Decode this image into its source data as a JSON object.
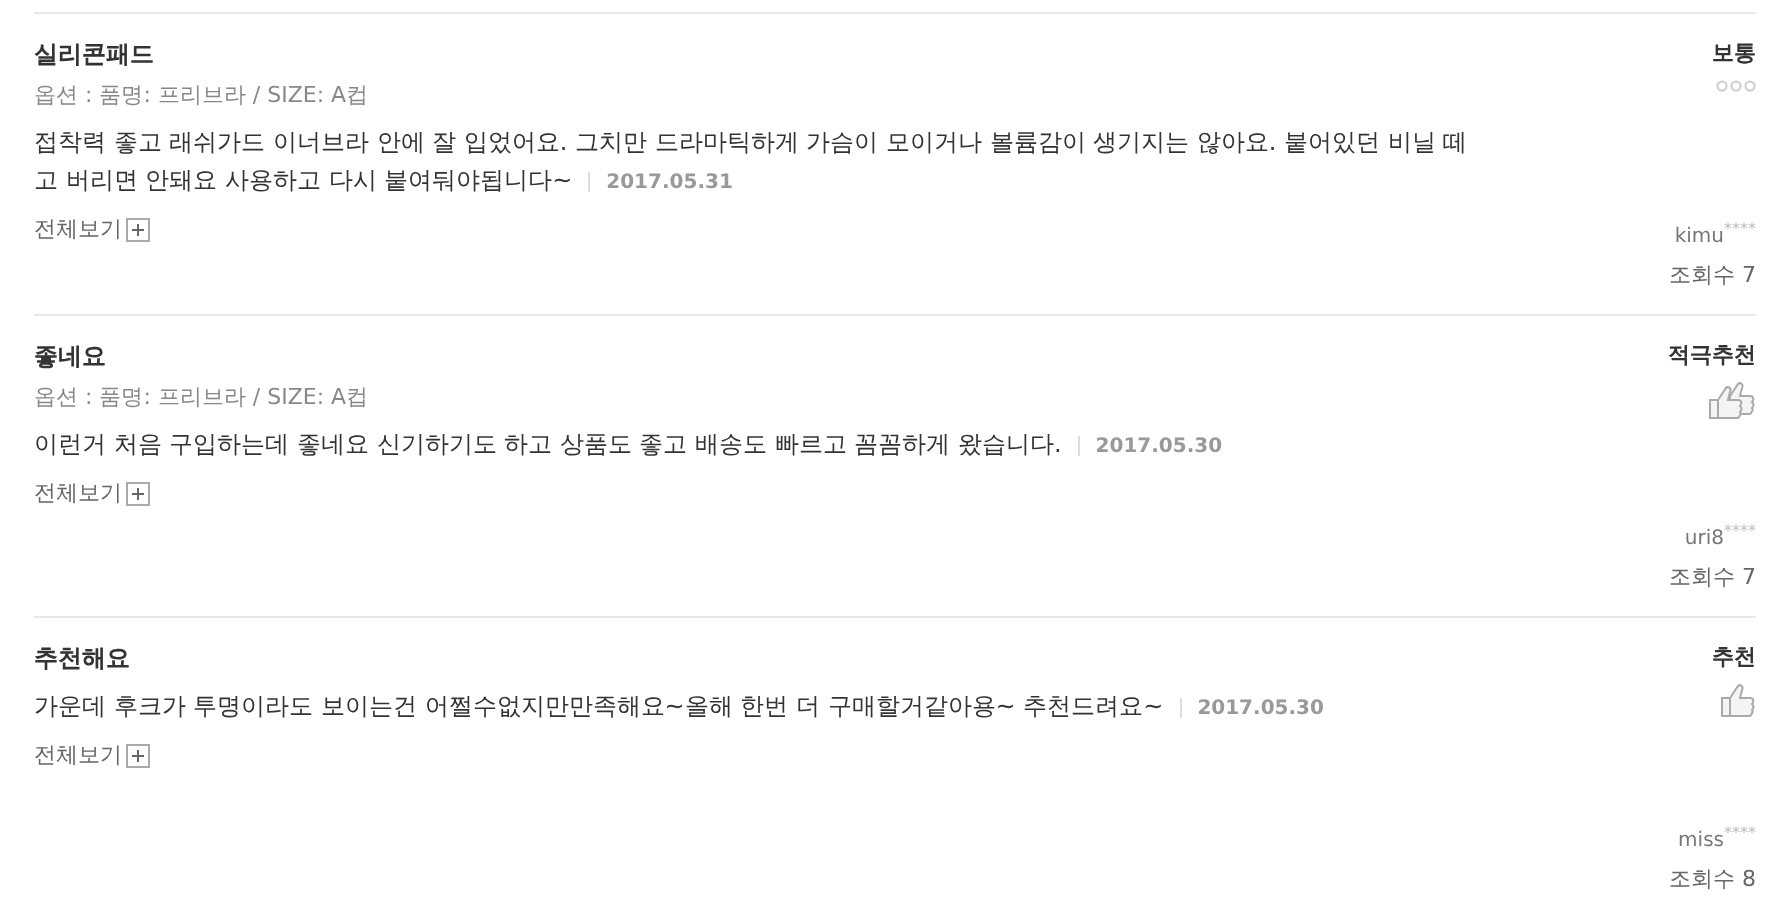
{
  "reviews": [
    {
      "title": "실리콘패드",
      "option": "옵션 : 품명: 프리브라 / SIZE: A컵",
      "content": [
        "접착력 좋고 래쉬가드 이너브라 안에 잘 입었어요. 그치만 드라마틱하게 가슴이 모이거나 볼륨감이 생기지는 않아요. 붙어있던 비닐 떼",
        "고 버리면 안돼요 사용하고 다시 붙여둬야됩니다~"
      ],
      "date": "2017.05.31",
      "more": "전체보기",
      "rating": {
        "kind": "dots",
        "label": "보통"
      },
      "user": "kimu$^{****}$",
      "views": "조회수 7"
    },
    {
      "title": "좋네요",
      "option": "옵션 : 품명: 프리브라 / SIZE: A컵",
      "content": [
        "이런거 처음 구입하는데 좋네요 신기하기도 하고 상품도 좋고 배송도 빠르고 꼼꼼하게 왔습니다."
      ],
      "date": "2017.05.30",
      "more": "전체보기",
      "rating": {
        "kind": "two_thumbs",
        "label": "적극추천"
      },
      "user": "uri8$^{****}$",
      "views": "조회수 7"
    },
    {
      "title": "추천해요",
      "content": [
        "가운데 후크가 투명이라도 보이는건 어쩔수없지만만족해요~올해 한번 더 구매할거같아용~ 추천드려요~"
      ],
      "date": "2017.05.30",
      "more": "전체보기",
      "rating": {
        "kind": "thumb",
        "label": "추천"
      },
      "user": "miss$^{****}$",
      "views": "조회수 8"
    }
  ]
}
